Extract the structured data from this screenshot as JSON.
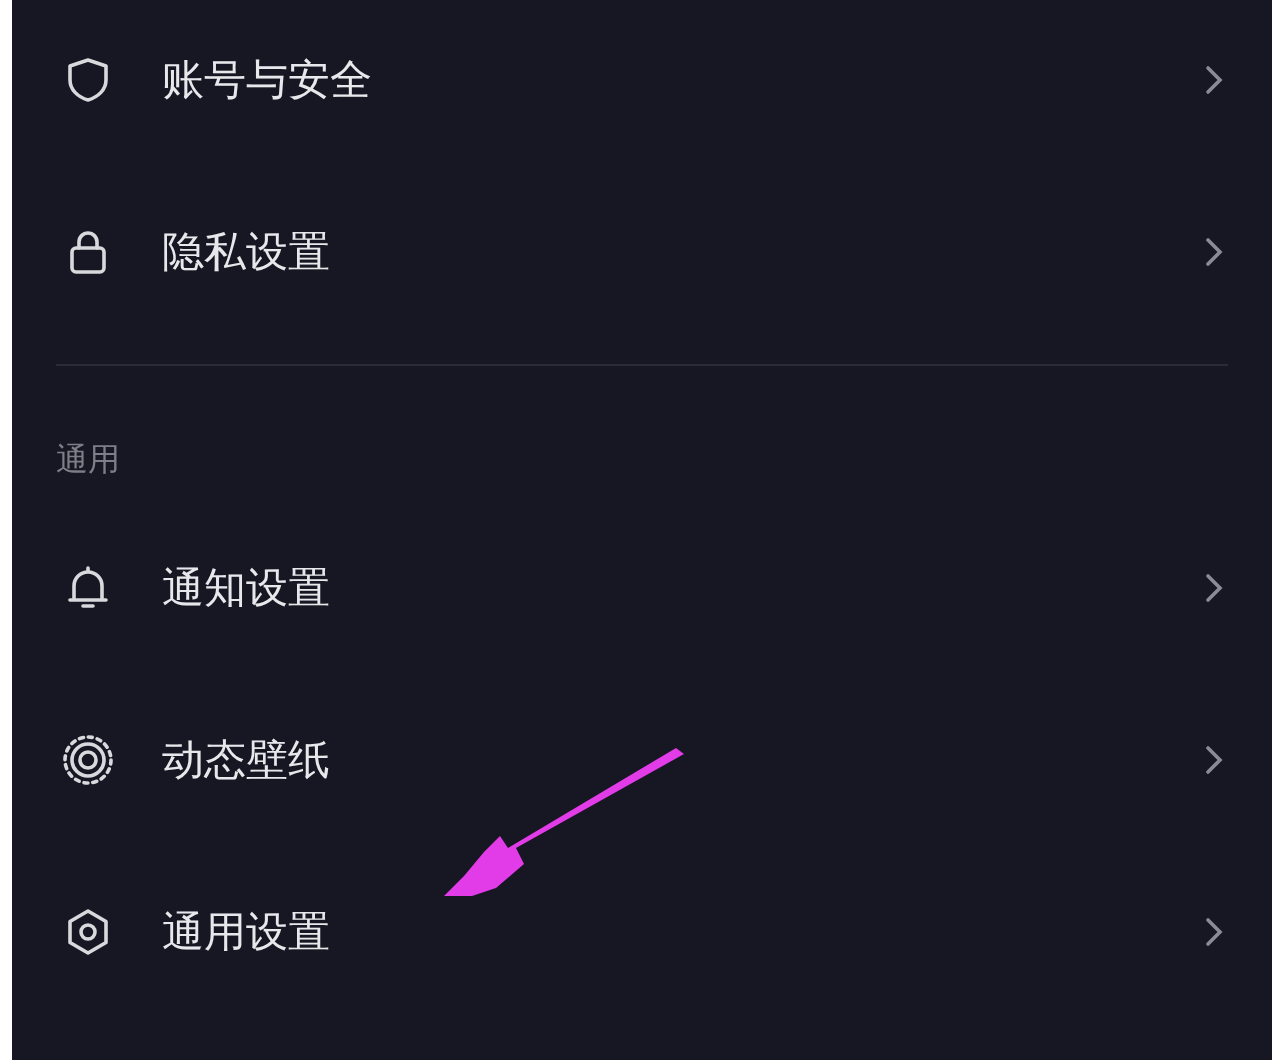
{
  "sections": [
    {
      "items": [
        {
          "label": "账号与安全"
        },
        {
          "label": "隐私设置"
        }
      ]
    },
    {
      "header": "通用",
      "items": [
        {
          "label": "通知设置"
        },
        {
          "label": "动态壁纸"
        },
        {
          "label": "通用设置"
        }
      ]
    }
  ]
}
